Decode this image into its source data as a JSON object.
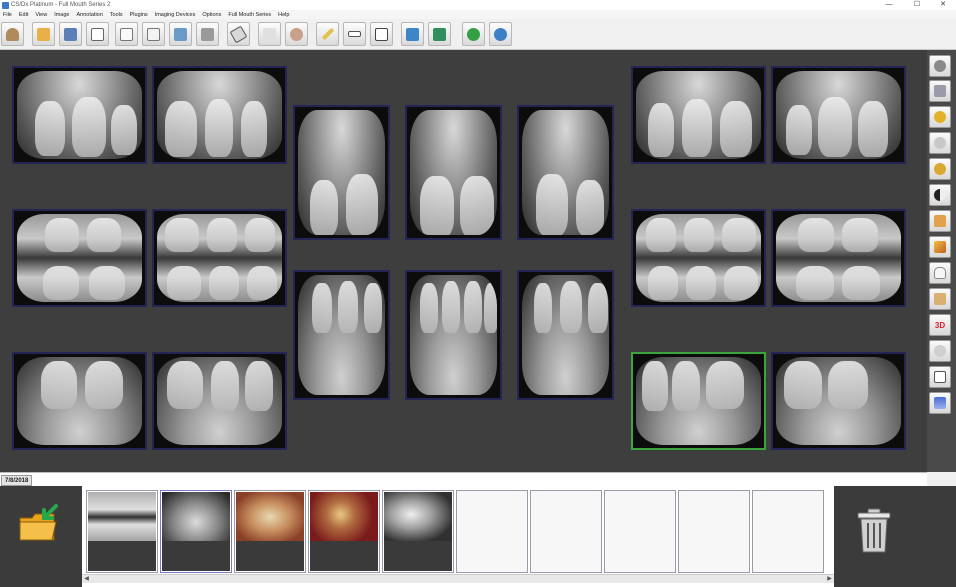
{
  "window": {
    "title": "CS/Dx Platinum - Full Mouth Series 2",
    "minimize": "—",
    "maximize": "☐",
    "close": "✕"
  },
  "menu": [
    "File",
    "Edit",
    "View",
    "Image",
    "Annotation",
    "Tools",
    "Plugins",
    "Imaging Devices",
    "Options",
    "Full Mouth Series",
    "Help"
  ],
  "toolbar_icons": [
    "patient-icon",
    "open-icon",
    "save-icon",
    "copy-icon",
    "new-document-icon",
    "document-icon",
    "export-icon",
    "print-icon",
    "eraser-icon",
    "compare-icon",
    "portrait-icon",
    "pencil-icon",
    "ruler-icon",
    "text-icon",
    "layout-icon",
    "monitor-icon",
    "globe-icon",
    "info-icon"
  ],
  "palette_icons": [
    "rotate-icon",
    "flip-icon",
    "zoom-in-icon",
    "zoom-out-icon",
    "magnify-icon",
    "contrast-icon",
    "sharpen-icon",
    "brightness-icon",
    "tooth-icon",
    "implant-icon",
    "3d-icon",
    "rotate-view-icon",
    "compare-view-icon",
    "gradient-icon"
  ],
  "palette_3d_label": "3D",
  "date_tab": "7/8/2018",
  "selected_xray": "lower-right-molar",
  "tray_thumbnails": [
    {
      "name": "bitewing-thumbnail",
      "kind": "xray"
    },
    {
      "name": "panoramic-thumbnail",
      "kind": "pano"
    },
    {
      "name": "intraoral-photo-thumbnail",
      "kind": "photo"
    },
    {
      "name": "crown-photo-thumbnail",
      "kind": "photo2"
    },
    {
      "name": "cephalometric-thumbnail",
      "kind": "ceph"
    },
    {
      "name": "empty-slot",
      "kind": "empty"
    },
    {
      "name": "empty-slot",
      "kind": "empty"
    },
    {
      "name": "empty-slot",
      "kind": "empty"
    },
    {
      "name": "empty-slot",
      "kind": "empty"
    },
    {
      "name": "empty-slot",
      "kind": "empty"
    }
  ],
  "colors": {
    "workspace_bg": "#3e3e3e",
    "xray_border": "#252555",
    "selected_border": "#3da53d",
    "folder_icon": "#e9a21c",
    "arrow_icon": "#27a84a",
    "3d_badge": "#d6242b"
  }
}
